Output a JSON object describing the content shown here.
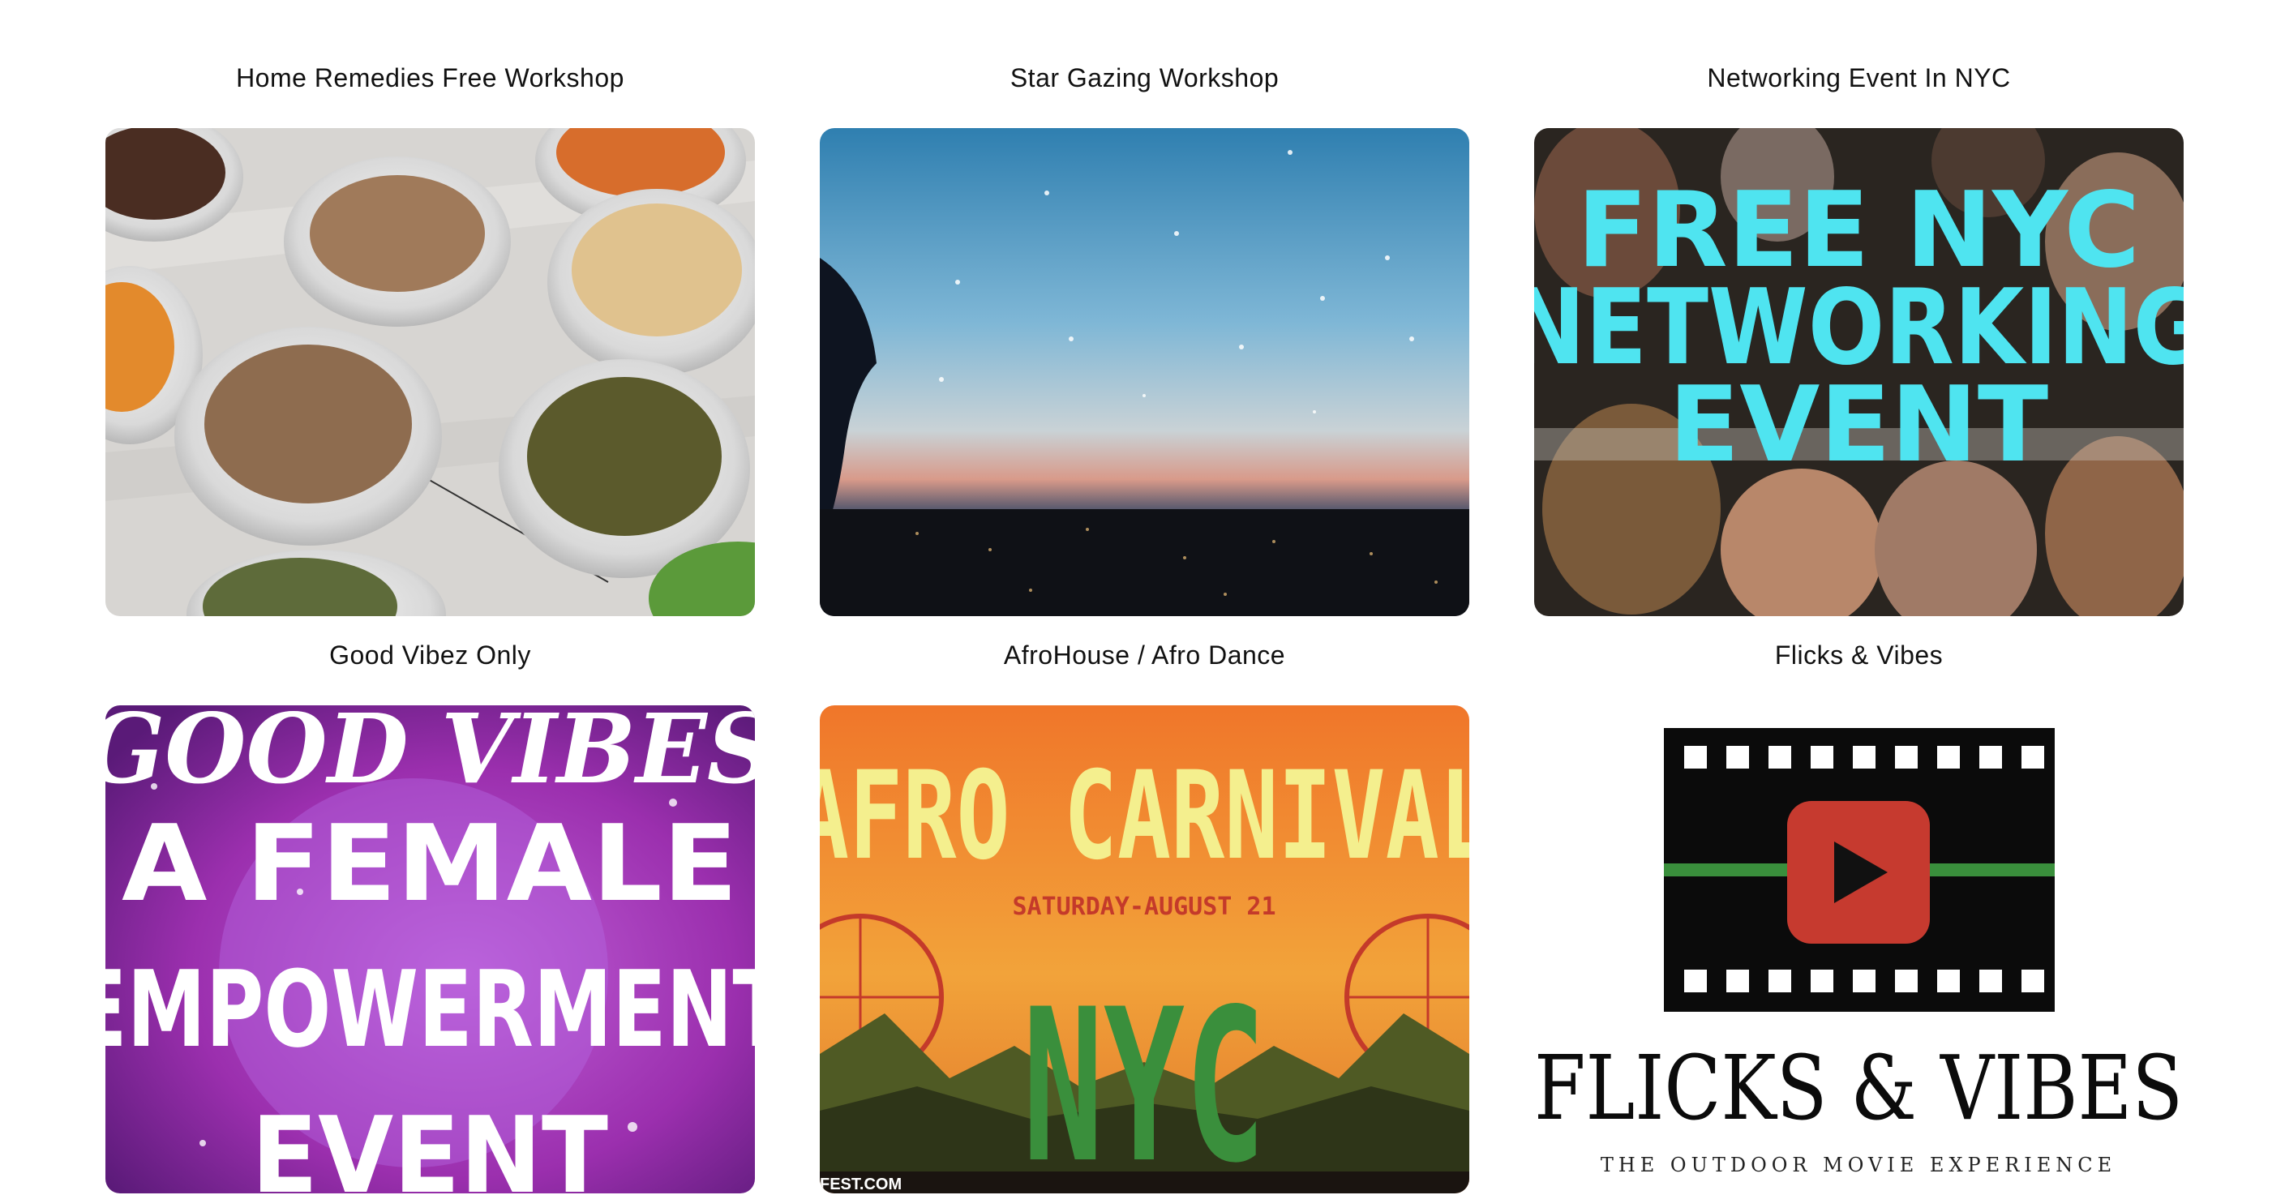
{
  "events": [
    {
      "title": "Home Remedies Free Workshop",
      "image_alt": "Bowls of spices",
      "icon": "spices-image"
    },
    {
      "title": "Star Gazing Workshop",
      "image_alt": "Night sky over city lights",
      "icon": "night-sky-image"
    },
    {
      "title": "Networking Event In NYC",
      "image_alt": "Crowd at networking event",
      "image_text": [
        "FREE NYC",
        "NETWORKING",
        "EVENT"
      ],
      "icon": "networking-image"
    },
    {
      "title": "Good Vibez Only",
      "image_alt": "Female empowerment poster",
      "image_text": [
        "GOOD VIBES",
        "A FEMALE",
        "EMPOWERMENT",
        "EVENT"
      ],
      "icon": "good-vibes-image"
    },
    {
      "title": "AfroHouse / Afro Dance",
      "image_alt": "Afro Carnival poster",
      "image_text": [
        "AFRO CARNIVAL",
        "SATURDAY-AUGUST 21",
        "NYC",
        "FEST.COM"
      ],
      "icon": "afro-carnival-image"
    },
    {
      "title": "Flicks & Vibes",
      "image_alt": "Film strip with play button logo",
      "image_text": [
        "FLICKS & VIBES",
        "THE OUTDOOR MOVIE EXPERIENCE"
      ],
      "icon": "film-play-icon"
    }
  ],
  "colors": {
    "cyan_text": "#4fe4f0",
    "vibes_purple": "#9b2fae",
    "carnival_orange": "#f0762a",
    "carnival_yellow": "#f4ef8e",
    "carnival_green": "#3a8f3c",
    "play_red": "#c63a2f"
  }
}
